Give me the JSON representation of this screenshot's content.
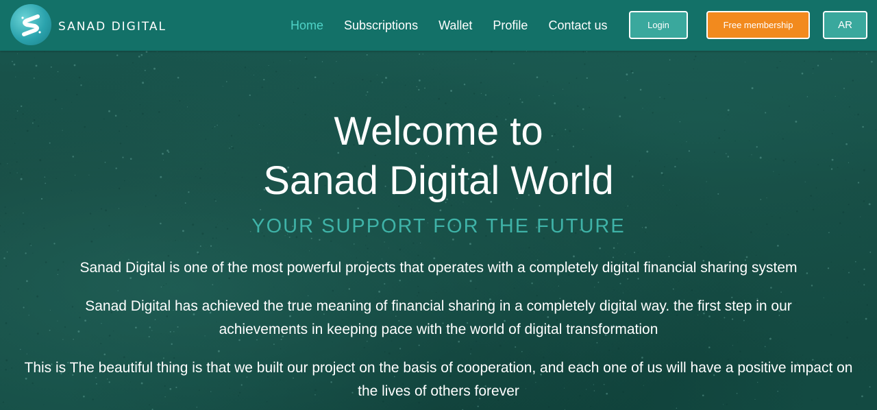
{
  "brand": {
    "name": "SANAD DIGITAL",
    "logo_icon": "sanad-s-logo-icon"
  },
  "nav": {
    "items": [
      {
        "label": "Home",
        "active": true
      },
      {
        "label": "Subscriptions",
        "active": false
      },
      {
        "label": "Wallet",
        "active": false
      },
      {
        "label": "Profile",
        "active": false
      },
      {
        "label": "Contact us",
        "active": false
      }
    ]
  },
  "header_buttons": {
    "login": "Login",
    "free_membership": "Free membership",
    "language": "AR"
  },
  "hero": {
    "title_line1": "Welcome to",
    "title_line2": "Sanad Digital World",
    "tagline": "YOUR SUPPORT FOR THE FUTURE",
    "paragraphs": [
      "Sanad Digital is one of the most powerful projects that operates with a completely digital financial sharing system",
      "Sanad Digital has achieved the true meaning of financial sharing in a completely digital way. the first step in our achievements in keeping pace with the world of digital transformation",
      "This is The beautiful thing is that we built our project on the basis of cooperation, and each one of us will have a positive impact on the lives of others forever"
    ]
  },
  "colors": {
    "header_bg": "#137168",
    "active_nav": "#4fd3c7",
    "login_bg": "#3aa89d",
    "free_membership_bg": "#f28a1e",
    "tagline": "#3fb3a8",
    "hero_bg": "#14463f"
  }
}
